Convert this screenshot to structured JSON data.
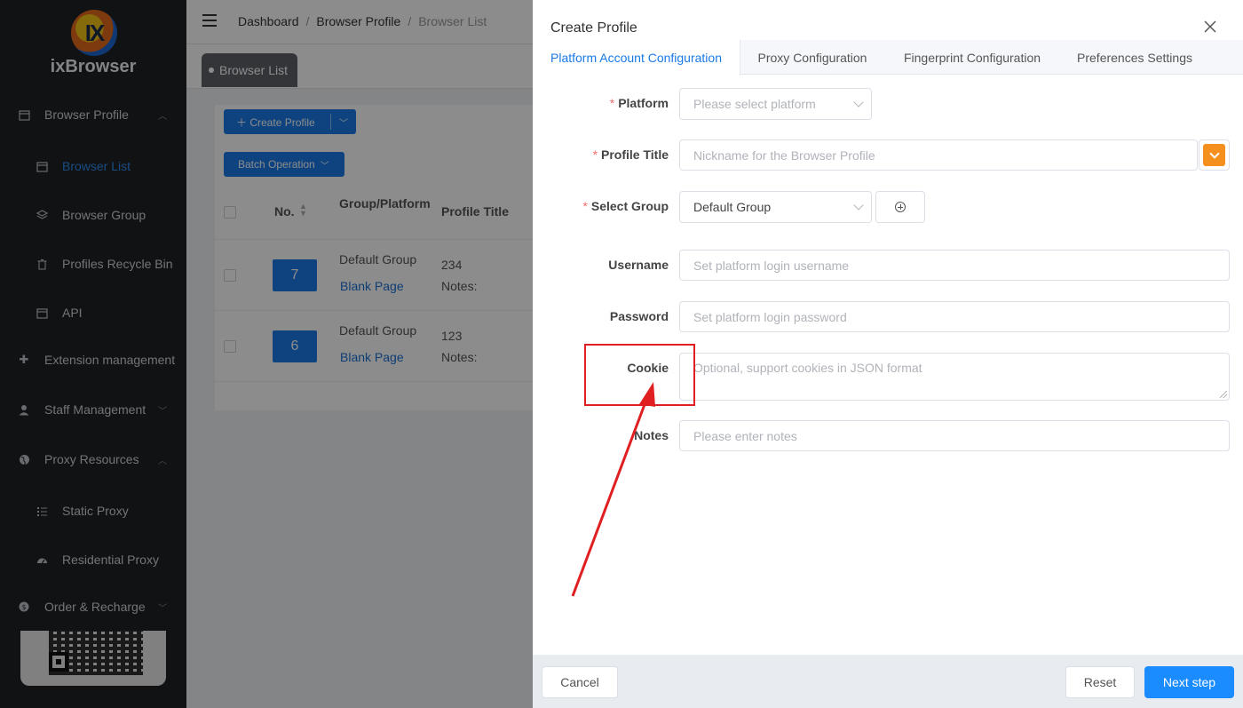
{
  "sidebar": {
    "brand": "ixBrowser",
    "logo_letters": "IX",
    "items": [
      {
        "label": "Browser Profile",
        "icon": "calendar-icon",
        "expanded": true
      },
      {
        "label": "Browser List",
        "icon": "calendar-icon",
        "active": true
      },
      {
        "label": "Browser Group",
        "icon": "layers-icon"
      },
      {
        "label": "Profiles Recycle Bin",
        "icon": "trash-icon"
      },
      {
        "label": "API",
        "icon": "calendar-icon"
      },
      {
        "label": "Extension management",
        "icon": "puzzle-icon"
      },
      {
        "label": "Staff Management",
        "icon": "user-gear-icon"
      },
      {
        "label": "Proxy Resources",
        "icon": "globe-icon",
        "expanded": true
      },
      {
        "label": "Static Proxy",
        "icon": "list-icon"
      },
      {
        "label": "Residential Proxy",
        "icon": "dashboard-icon"
      },
      {
        "label": "Order & Recharge",
        "icon": "coin-icon"
      }
    ]
  },
  "header": {
    "breadcrumb": [
      "Dashboard",
      "Browser Profile",
      "Browser List"
    ],
    "separator": "/"
  },
  "tags": {
    "active_tag": "Browser List"
  },
  "list": {
    "create_button": "Create Profile",
    "batch_button": "Batch Operation",
    "columns": {
      "no": "No.",
      "group": "Group/Platform",
      "title": "Profile Title"
    },
    "rows": [
      {
        "no": "7",
        "group": "Default Group",
        "platform": "Blank Page",
        "title": "234",
        "notes": "Notes:"
      },
      {
        "no": "6",
        "group": "Default Group",
        "platform": "Blank Page",
        "title": "123",
        "notes": "Notes:"
      }
    ]
  },
  "drawer": {
    "title": "Create Profile",
    "tabs": [
      "Platform Account Configuration",
      "Proxy Configuration",
      "Fingerprint Configuration",
      "Preferences Settings"
    ],
    "active_tab": 0,
    "fields": {
      "platform": {
        "label": "Platform",
        "required": true,
        "placeholder": "Please select platform"
      },
      "profile_title": {
        "label": "Profile Title",
        "required": true,
        "placeholder": "Nickname for the Browser Profile"
      },
      "select_group": {
        "label": "Select Group",
        "required": true,
        "value": "Default Group"
      },
      "username": {
        "label": "Username",
        "placeholder": "Set platform login username"
      },
      "password": {
        "label": "Password",
        "placeholder": "Set platform login password"
      },
      "cookie": {
        "label": "Cookie",
        "placeholder": "Optional, support cookies in JSON format"
      },
      "notes": {
        "label": "Notes",
        "placeholder": "Please enter notes"
      }
    },
    "required_mark": "*",
    "footer": {
      "cancel": "Cancel",
      "reset": "Reset",
      "next": "Next step"
    }
  },
  "colors": {
    "primary": "#1a7ae8",
    "sidebar_bg": "#1f2124",
    "annotation_red": "#e02020",
    "orange": "#f5901e"
  }
}
